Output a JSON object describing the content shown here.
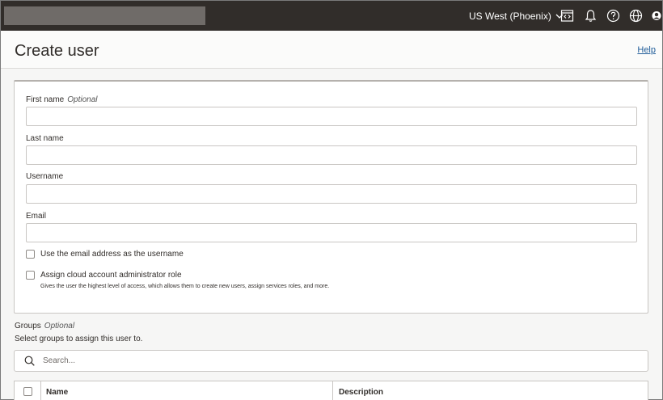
{
  "topbar": {
    "region_label": "US West (Phoenix)",
    "icons": [
      "code-editor-icon",
      "bell-icon",
      "help-circle-icon",
      "globe-icon",
      "profile-icon"
    ]
  },
  "header": {
    "title": "Create user",
    "help_link": "Help"
  },
  "form": {
    "first_name": {
      "label": "First name",
      "optional": "Optional",
      "value": ""
    },
    "last_name": {
      "label": "Last name",
      "value": ""
    },
    "username": {
      "label": "Username",
      "value": ""
    },
    "email": {
      "label": "Email",
      "value": ""
    },
    "use_email_checkbox": {
      "label": "Use the email address as the username",
      "checked": false
    },
    "admin_role_checkbox": {
      "label": "Assign cloud account administrator role",
      "help": "Gives the user the highest level of access, which allows them to create new users, assign services roles, and more.",
      "checked": false
    }
  },
  "groups": {
    "label": "Groups",
    "optional": "Optional",
    "description": "Select groups to assign this user to.",
    "search_placeholder": "Search...",
    "table_columns": [
      "Name",
      "Description"
    ]
  },
  "colors": {
    "topbar_bg": "#312d2a",
    "link": "#1f5c99",
    "page_bg": "#f6f6f5"
  }
}
